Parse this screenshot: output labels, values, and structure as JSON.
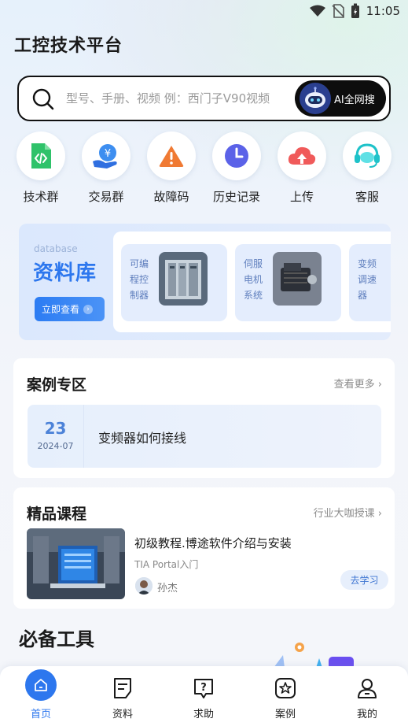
{
  "status_bar": {
    "time": "11:05"
  },
  "app": {
    "title": "工控技术平台"
  },
  "search": {
    "placeholder": "型号、手册、视频 例：西门子V90视频",
    "ai_button": "AI全网搜"
  },
  "quick_nav": [
    {
      "label": "技术群",
      "icon": "code-file-icon",
      "color": "#2fc26a"
    },
    {
      "label": "交易群",
      "icon": "yuan-hand-icon",
      "color": "#3d8ef0"
    },
    {
      "label": "故障码",
      "icon": "warning-icon",
      "color": "#f07a33"
    },
    {
      "label": "历史记录",
      "icon": "clock-icon",
      "color": "#5b62e8"
    },
    {
      "label": "上传",
      "icon": "cloud-upload-icon",
      "color": "#f05a5a"
    },
    {
      "label": "客服",
      "icon": "headset-icon",
      "color": "#1ec2c9"
    }
  ],
  "database": {
    "label_en": "database",
    "label_cn": "资料库",
    "button": "立即查看",
    "items": [
      {
        "label": "可编程控制器"
      },
      {
        "label": "伺服电机系统"
      },
      {
        "label": "变频调速器"
      }
    ]
  },
  "cases": {
    "title": "案例专区",
    "more": "查看更多",
    "items": [
      {
        "day": "23",
        "month": "2024-07",
        "title": "变频器如何接线"
      }
    ]
  },
  "courses": {
    "title": "精品课程",
    "more": "行业大咖授课",
    "items": [
      {
        "name": "初级教程.博途软件介绍与安装",
        "subtitle": "TIA Portal入门",
        "teacher": "孙杰",
        "button": "去学习"
      }
    ]
  },
  "tools": {
    "title": "必备工具"
  },
  "bottom_nav": [
    {
      "label": "首页",
      "icon": "home-icon",
      "active": true
    },
    {
      "label": "资料",
      "icon": "document-icon",
      "active": false
    },
    {
      "label": "求助",
      "icon": "help-icon",
      "active": false
    },
    {
      "label": "案例",
      "icon": "star-badge-icon",
      "active": false
    },
    {
      "label": "我的",
      "icon": "user-icon",
      "active": false
    }
  ],
  "colors": {
    "accent": "#2d77ee",
    "background": "#f4f6fa"
  }
}
